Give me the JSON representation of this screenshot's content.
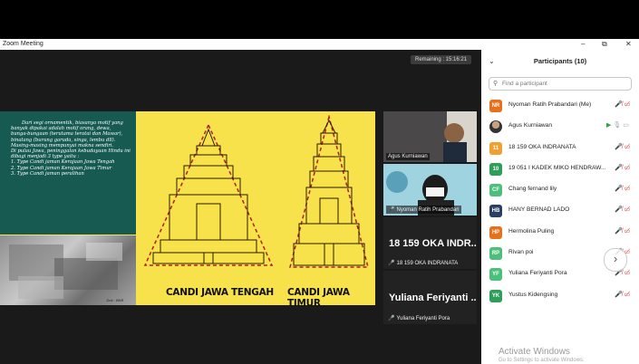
{
  "window": {
    "title": "Zoom Meeting",
    "controls": [
      "–",
      "⧉",
      "✕"
    ]
  },
  "meeting": {
    "remaining": "Remaining : 15:16:21"
  },
  "slide": {
    "text": [
      "Dari segi ornamentik, biasanya motif yang",
      "banyak dipakai adalah motif orang, dewa,",
      "bunga-bungaan (terutama teratai dan Mawar),",
      "binatang (burung garuda, singa, lembu dll).",
      "Masing-masing mempunyai makna sendiri.",
      "Di pulau Jawa, peninggalan kebudayaan Hindu ini",
      "dibagi menjadi 3 type yaitu :",
      "1.    Type Candi jaman Kerajaan Jawa Tengah",
      "2.    Type Candi jaman Kerajaan Jawa Timur",
      "3.    Type Candi jaman peralihan"
    ],
    "photo_credit": "Dok : BKB",
    "caption_left": "CANDI JAWA TENGAH",
    "caption_right": "CANDI JAWA TIMUR"
  },
  "videos": [
    {
      "name": "Agus Kurniawan"
    },
    {
      "name": "Nyoman Ratih Prabandari"
    },
    {
      "big": "18 159 OKA INDR...",
      "name": "18 159 OKA INDRANATA"
    },
    {
      "big": "Yuliana Feriyanti ...",
      "name": "Yuliana Feriyanti Pora"
    }
  ],
  "participants": {
    "title": "Participants (10)",
    "search_placeholder": "Find a participant",
    "list": [
      {
        "initials": "NR",
        "color": "#e8701a",
        "name": "Nyoman Ratih Prabandari (Me)",
        "video": false
      },
      {
        "initials": "",
        "color": "#444444",
        "name": "Agus Kurniawan",
        "video": true
      },
      {
        "initials": "11",
        "color": "#f0a030",
        "name": "18 159 OKA INDRANATA",
        "video": false
      },
      {
        "initials": "10",
        "color": "#2f9e5a",
        "name": "19 051 I KADEK MIKO HENDRAW...",
        "video": false
      },
      {
        "initials": "CF",
        "color": "#4cbf7a",
        "name": "Chang fernand lily",
        "video": false
      },
      {
        "initials": "HB",
        "color": "#2b3f63",
        "name": "HANY BERNAD LADO",
        "video": false
      },
      {
        "initials": "HP",
        "color": "#e8701a",
        "name": "Hermolina Puling",
        "video": false
      },
      {
        "initials": "RP",
        "color": "#4cbf7a",
        "name": "Rivan poi",
        "video": false
      },
      {
        "initials": "YF",
        "color": "#4cbf7a",
        "name": "Yuliana Feriyanti Pora",
        "video": false
      },
      {
        "initials": "YK",
        "color": "#2f9e5a",
        "name": "Yustus Kidengsing",
        "video": false
      }
    ]
  },
  "watermark": {
    "line1": "Activate Windows",
    "line2": "Go to Settings to activate Windows."
  }
}
